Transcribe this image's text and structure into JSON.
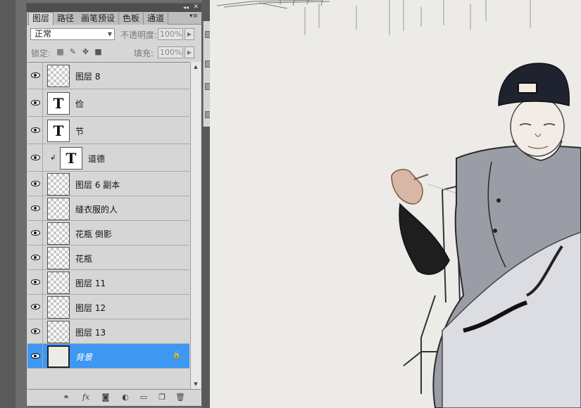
{
  "panel": {
    "tabs": [
      "图层",
      "路径",
      "画笔预设",
      "色板",
      "通道"
    ],
    "active_tab": "图层",
    "collapse_glyph": "◂◂",
    "close_glyph": "✕",
    "menu_glyph": "▾≡"
  },
  "controls": {
    "blend_mode": "正常",
    "opacity_label": "不透明度:",
    "opacity_value": "100%",
    "lock_label": "锁定:",
    "fill_label": "填充:",
    "fill_value": "100%"
  },
  "layers": [
    {
      "name": "图层 8",
      "type": "pixel",
      "visible": true
    },
    {
      "name": "俭",
      "type": "text",
      "visible": true
    },
    {
      "name": "节",
      "type": "text",
      "visible": true
    },
    {
      "name": "道德",
      "type": "text",
      "visible": true,
      "clipped": true
    },
    {
      "name": "图层 6 副本",
      "type": "pixel",
      "visible": true
    },
    {
      "name": "缝衣服的人",
      "type": "pixel",
      "visible": true
    },
    {
      "name": "花瓶 倒影",
      "type": "pixel",
      "visible": true
    },
    {
      "name": "花瓶",
      "type": "pixel",
      "visible": true
    },
    {
      "name": "图层 11",
      "type": "pixel",
      "visible": true
    },
    {
      "name": "图层 12",
      "type": "pixel",
      "visible": true
    },
    {
      "name": "图层 13",
      "type": "pixel",
      "visible": true
    },
    {
      "name": "背景",
      "type": "background",
      "visible": true,
      "selected": true,
      "locked": true
    }
  ],
  "text_thumb_glyph": "T",
  "clip_glyph": "↲",
  "lock_glyph": "🔒",
  "bottom_icons": [
    "link-layers-icon",
    "fx-icon",
    "mask-icon",
    "adjustment-icon",
    "group-icon",
    "new-layer-icon",
    "trash-icon"
  ],
  "bottom_fx_label": "fx",
  "colors": {
    "selection": "#3d97f3",
    "panel_bg": "#d6d6d6",
    "canvas_bg": "#ecebe7"
  }
}
